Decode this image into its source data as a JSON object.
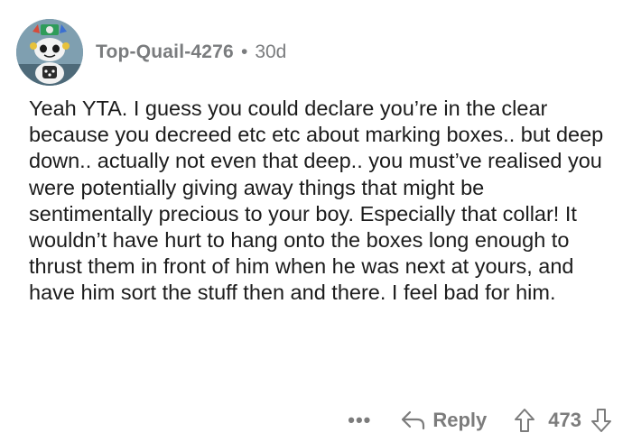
{
  "comment": {
    "author": "Top-Quail-4276",
    "separator": "•",
    "age": "30d",
    "body": "Yeah YTA. I guess you could declare you’re in the clear because you decreed etc etc about marking boxes.. but deep down.. actually not even that deep.. you must’ve realised you were potentially giving away things that might be sentimentally precious to your boy. Especially that collar! It wouldn’t have hurt to hang onto the boxes long enough to thrust them in front of him when he was next at yours, and have him sort the stuff then and there. I feel bad for him."
  },
  "actions": {
    "more_label": "•••",
    "reply_label": "Reply",
    "score": "473"
  },
  "icons": {
    "avatar": "snoo-avatar",
    "reply": "reply-arrow-icon",
    "upvote": "upvote-arrow-icon",
    "downvote": "downvote-arrow-icon"
  },
  "colors": {
    "meta_text": "#7a7c7e",
    "body_text": "#1c1c1c",
    "background": "#ffffff"
  }
}
